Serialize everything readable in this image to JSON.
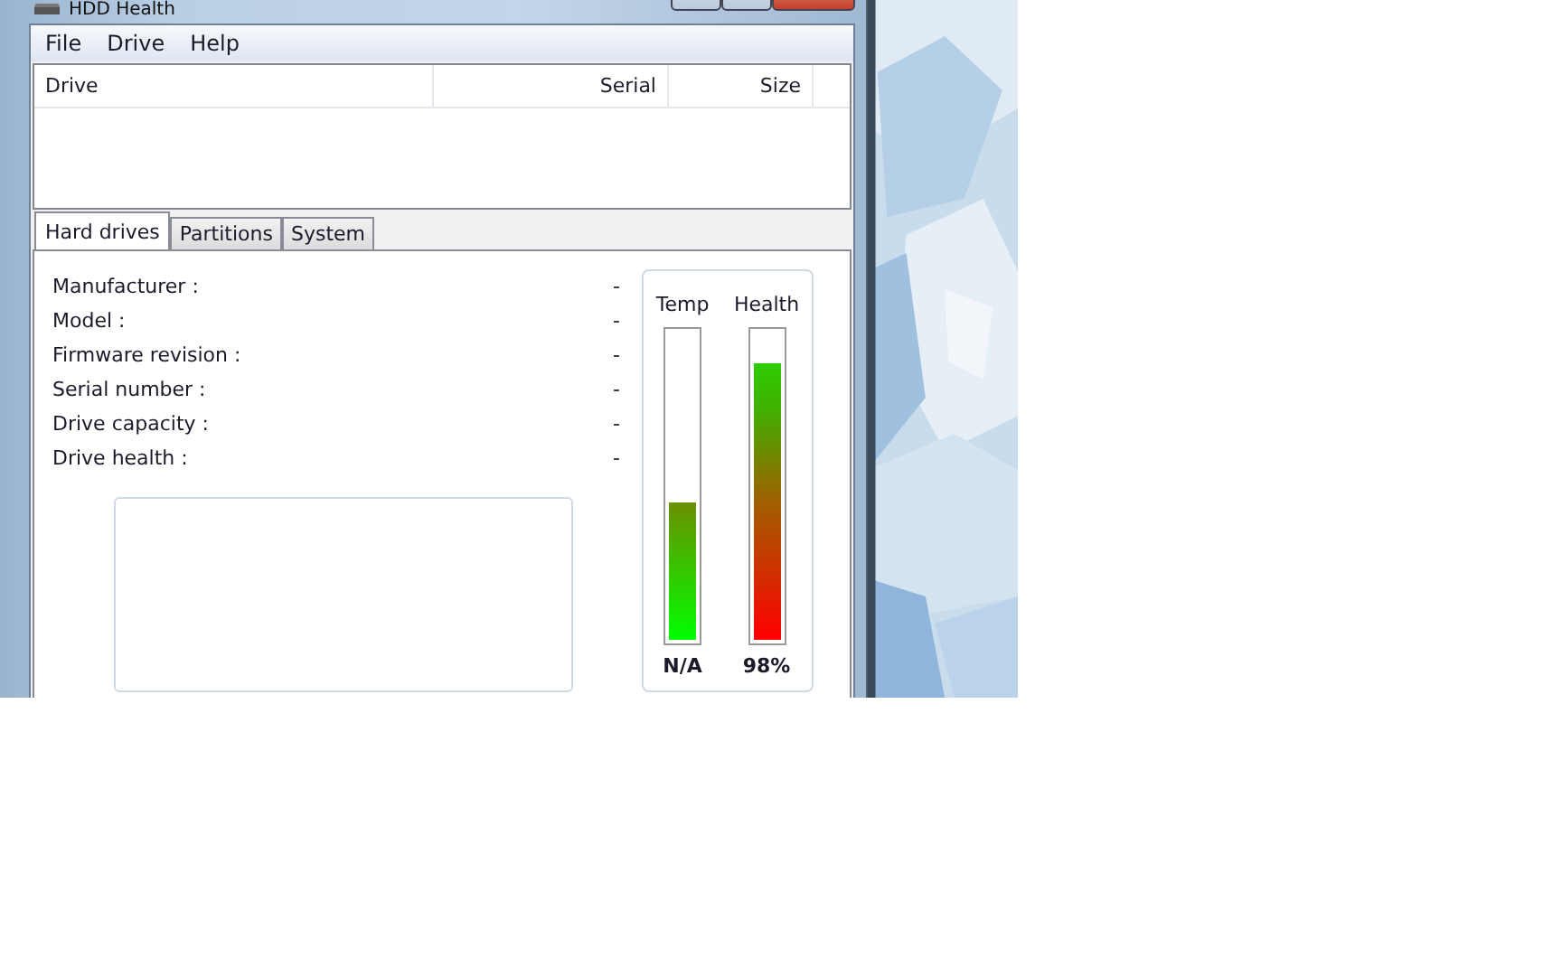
{
  "window": {
    "title": "HDD Health"
  },
  "menu": [
    "File",
    "Drive",
    "Help"
  ],
  "drive_list": {
    "columns": [
      "Drive",
      "Serial",
      "Size"
    ]
  },
  "tabs": [
    {
      "label": "Hard drives",
      "selected": true
    },
    {
      "label": "Partitions",
      "selected": false
    },
    {
      "label": "System",
      "selected": false
    }
  ],
  "details": [
    {
      "label": "Manufacturer :",
      "value": "-"
    },
    {
      "label": "Model :",
      "value": "-"
    },
    {
      "label": "Firmware revision :",
      "value": "-"
    },
    {
      "label": "Serial number :",
      "value": "-"
    },
    {
      "label": "Drive capacity :",
      "value": "-"
    },
    {
      "label": "Drive health :",
      "value": "-"
    }
  ],
  "gauges": [
    {
      "kind": "temperature",
      "label": "Temp",
      "level": 0.45,
      "reading": "N/A"
    },
    {
      "kind": "health",
      "label": "Health",
      "level": 0.9,
      "reading": "98%"
    }
  ]
}
